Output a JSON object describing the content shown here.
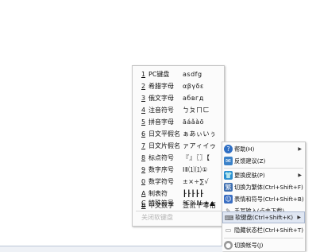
{
  "soft_keyboard_menu": {
    "items": [
      {
        "num": "1",
        "label": "PC键盘",
        "symbols": "asdfg"
      },
      {
        "num": "2",
        "label": "希腊字母",
        "symbols": "αβγδε"
      },
      {
        "num": "3",
        "label": "俄文字母",
        "symbols": "абвгд"
      },
      {
        "num": "4",
        "label": "注音符号",
        "symbols": "ㄅㄆㄇㄈ"
      },
      {
        "num": "5",
        "label": "拼音字母",
        "symbols": "āáǎàō"
      },
      {
        "num": "6",
        "label": "日文平假名",
        "symbols": "ぁあぃいぅ"
      },
      {
        "num": "7",
        "label": "日文片假名",
        "symbols": "ァアィイゥ"
      },
      {
        "num": "8",
        "label": "标点符号",
        "symbols": "『』〖〗【"
      },
      {
        "num": "9",
        "label": "数字序号",
        "symbols": "ⅠⅡ⑴⑴①"
      },
      {
        "num": "0",
        "label": "数学符号",
        "symbols": "±×÷∑√"
      },
      {
        "num": "A",
        "label": "制表符",
        "symbols": "┠┠┠┠┠"
      },
      {
        "num": "B",
        "label": "中文数字",
        "symbols": "壹贰千零佰"
      },
      {
        "num": "C",
        "label": "特殊符号",
        "symbols": "℃%№★▲"
      }
    ],
    "close_label": "关闭软键盘"
  },
  "main_menu": {
    "items": [
      {
        "icon": "help-icon",
        "label": "帮助(H)",
        "arrow": true
      },
      {
        "icon": "feedback-icon",
        "label": "反馈建议(Z)",
        "arrow": false
      },
      {
        "icon": "skin-icon",
        "label": "更换皮肤(P)",
        "arrow": true
      },
      {
        "icon": "convert-icon",
        "label": "切换为繁体(Ctrl+Shift+F)",
        "arrow": false
      },
      {
        "icon": "emoji-icon",
        "label": "表情和符号(Ctrl+Shift+B)",
        "arrow": false
      },
      {
        "icon": "handwrite-icon",
        "label": "手写输入(点击下载)",
        "arrow": false
      },
      {
        "icon": "keyboard-icon",
        "label": "软键盘(Ctrl+Shift+K)",
        "arrow": true
      },
      {
        "icon": "hide-statusbar-icon",
        "label": "隐藏状态栏(Ctrl+Shift+T)",
        "arrow": false
      },
      {
        "icon": "switch-account-icon",
        "label": "切换帐号(J)",
        "arrow": false
      }
    ],
    "highlighted_index": 6
  },
  "colors": {
    "help": "#2f6fc4",
    "feedback": "#3b82c9",
    "skin": "#2a8fd0",
    "convert": "#3f6fb0",
    "emoji": "#3a6ec2",
    "highlight": "#dfe6f2"
  }
}
